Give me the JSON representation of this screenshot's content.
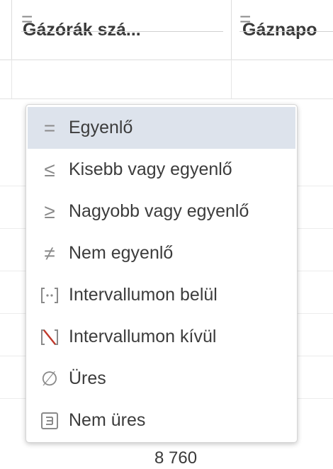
{
  "grid": {
    "columns": [
      {
        "header": "Gázórák szá..."
      },
      {
        "header": "Gáznapo"
      }
    ],
    "filter_values": [
      "=",
      "="
    ],
    "footer_value": "8 760"
  },
  "dropdown": {
    "selected_index": 0,
    "items": [
      {
        "icon": "equals-icon",
        "glyph": "=",
        "label": "Egyenlő"
      },
      {
        "icon": "less-or-equal-icon",
        "glyph": "≤",
        "label": "Kisebb vagy egyenlő"
      },
      {
        "icon": "greater-or-equal-icon",
        "glyph": "≥",
        "label": "Nagyobb vagy egyenlő"
      },
      {
        "icon": "not-equal-icon",
        "glyph": "≠",
        "label": "Nem egyenlő"
      },
      {
        "icon": "in-range-icon",
        "glyph": "[··]",
        "label": "Intervallumon belül"
      },
      {
        "icon": "out-of-range-icon",
        "glyph": "[\\]",
        "label": "Intervallumon kívül"
      },
      {
        "icon": "empty-set-icon",
        "glyph": "∅",
        "label": "Üres"
      },
      {
        "icon": "not-empty-icon",
        "glyph": "[≡]",
        "label": "Nem üres"
      }
    ]
  },
  "colors": {
    "selected_background": "#dde3ec",
    "icon_gray": "#8a8a8a",
    "out_of_range_accent": "#c0392b"
  }
}
